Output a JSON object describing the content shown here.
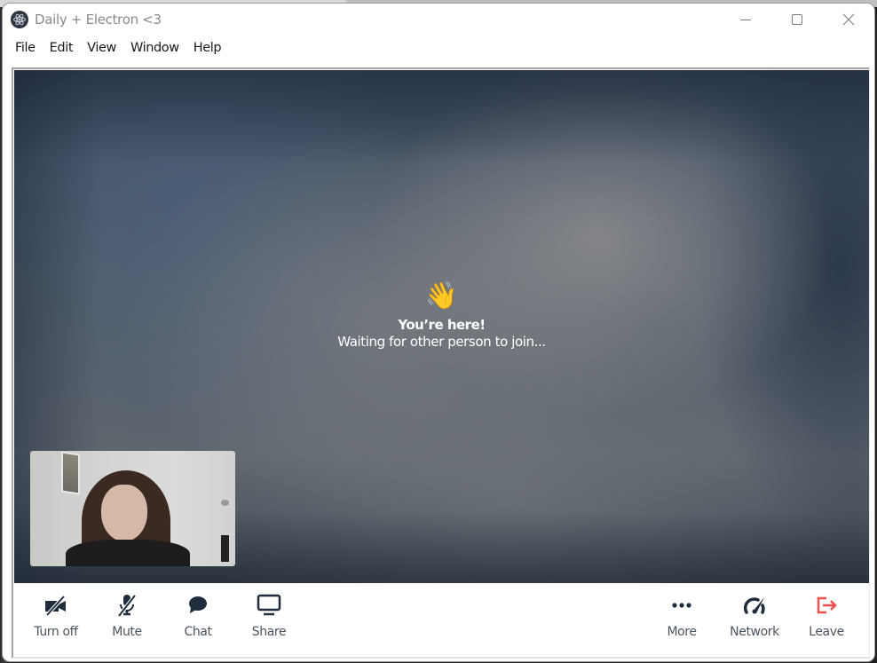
{
  "window": {
    "title": "Daily + Electron <3",
    "app_icon": "electron-logo-icon",
    "controls": [
      {
        "name": "minimize",
        "icon": "minimize-icon"
      },
      {
        "name": "maximize",
        "icon": "maximize-icon"
      },
      {
        "name": "close",
        "icon": "close-icon"
      }
    ]
  },
  "menubar": {
    "items": [
      {
        "label": "File"
      },
      {
        "label": "Edit"
      },
      {
        "label": "View"
      },
      {
        "label": "Window"
      },
      {
        "label": "Help"
      }
    ]
  },
  "call": {
    "waiting_emoji": "👋",
    "waiting_title": "You’re here!",
    "waiting_subtitle": "Waiting for other person to join..."
  },
  "self_view": {
    "description": "local camera preview"
  },
  "tray": {
    "left": [
      {
        "label": "Turn off",
        "icon": "camera-off-icon"
      },
      {
        "label": "Mute",
        "icon": "microphone-off-icon"
      },
      {
        "label": "Chat",
        "icon": "chat-bubble-icon"
      },
      {
        "label": "Share",
        "icon": "screen-share-icon"
      }
    ],
    "right": [
      {
        "label": "More",
        "icon": "more-dots-icon"
      },
      {
        "label": "Network",
        "icon": "network-gauge-icon"
      },
      {
        "label": "Leave",
        "icon": "leave-icon"
      }
    ]
  },
  "colors": {
    "icon_dark": "#1f2d3d",
    "label_gray": "#4a5560",
    "leave_red": "#f24e4e",
    "title_gray": "#8a8a8a"
  }
}
